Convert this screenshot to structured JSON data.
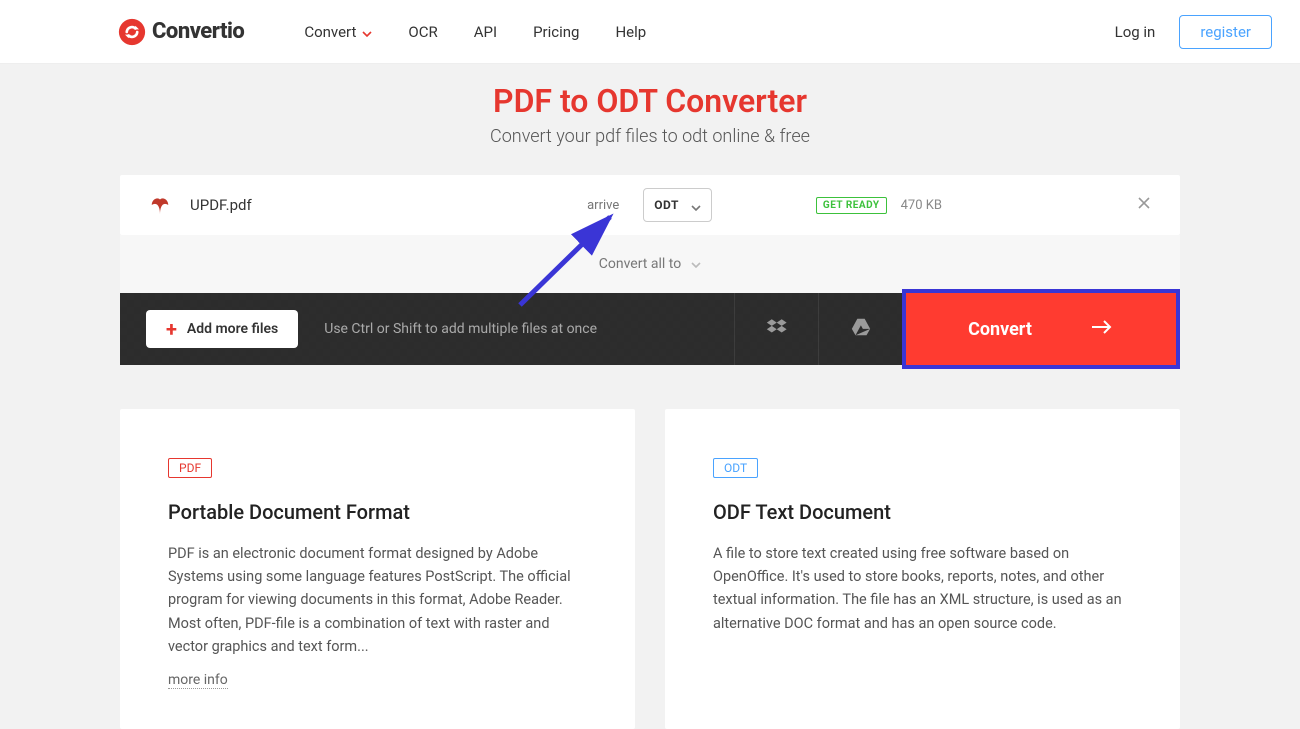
{
  "header": {
    "brand": "Convertio",
    "nav": {
      "convert": "Convert",
      "ocr": "OCR",
      "api": "API",
      "pricing": "Pricing",
      "help": "Help"
    },
    "login": "Log in",
    "register": "register"
  },
  "hero": {
    "title": "PDF to ODT Converter",
    "subtitle": "Convert your pdf files to odt online & free"
  },
  "file": {
    "name": "UPDF.pdf",
    "arrive_label": "arrive",
    "target_format": "ODT",
    "status": "GET READY",
    "size": "470 KB"
  },
  "convert_all": {
    "label": "Convert all to"
  },
  "actions": {
    "add_more": "Add more files",
    "hint": "Use Ctrl or Shift to add multiple files at once",
    "convert": "Convert"
  },
  "cards": {
    "pdf": {
      "badge": "PDF",
      "title": "Portable Document Format",
      "desc": "PDF is an electronic document format designed by Adobe Systems using some language features PostScript. The official program for viewing documents in this format, Adobe Reader. Most often, PDF-file is a combination of text with raster and vector graphics and text form...",
      "more": "more info"
    },
    "odt": {
      "badge": "ODT",
      "title": "ODF Text Document",
      "desc": "A file to store text created using free software based on OpenOffice. It's used to store books, reports, notes, and other textual information. The file has an XML structure, is used as an alternative DOC format and has an open source code."
    }
  }
}
